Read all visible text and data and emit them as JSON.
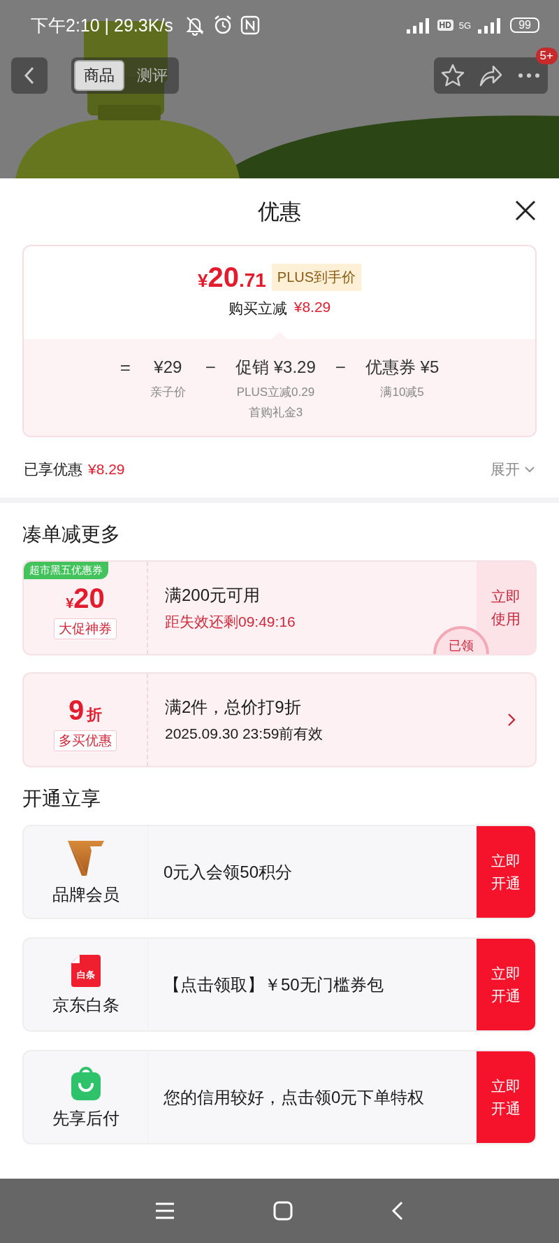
{
  "status_bar": {
    "time": "下午2:10 | 29.3K/s",
    "hd": "HD",
    "network": "5G",
    "battery": "99"
  },
  "header": {
    "tabs": [
      {
        "label": "商品",
        "selected": true
      },
      {
        "label": "测评",
        "selected": false
      }
    ],
    "badge": "5+"
  },
  "sheet": {
    "title": "优惠"
  },
  "price_card": {
    "currency": "¥",
    "price_int": "20",
    "price_dec": ".71",
    "price_tag": "PLUS到手价",
    "saving_label": "购买立减",
    "saving_value": "¥8.29",
    "formula": [
      {
        "kind": "operator",
        "text": "="
      },
      {
        "kind": "term",
        "value": "¥29",
        "notes": [
          "亲子价"
        ]
      },
      {
        "kind": "operator",
        "text": "−"
      },
      {
        "kind": "term",
        "label": "促销",
        "value": "¥3.29",
        "notes": [
          "PLUS立减0.29",
          "首购礼金3"
        ]
      },
      {
        "kind": "operator",
        "text": "−"
      },
      {
        "kind": "term",
        "label": "优惠券",
        "value": "¥5",
        "notes": [
          "满10减5"
        ]
      }
    ]
  },
  "enjoyed": {
    "label": "已享优惠",
    "value": "¥8.29",
    "expand": "展开"
  },
  "bundle": {
    "title": "凑单减更多",
    "offers": [
      {
        "kind": "coupon",
        "tag": "超市黑五优惠券",
        "unit_before": "¥",
        "amount": "20",
        "label": "大促神券",
        "title": "满200元可用",
        "subtitle": "距失效还剩09:49:16",
        "action": "立即使用",
        "stamp": "已领"
      },
      {
        "kind": "discount",
        "amount": "9",
        "unit_after": "折",
        "label": "多买优惠",
        "title": "满2件，总价打9折",
        "subtitle": "2025.09.30 23:59前有效"
      }
    ]
  },
  "membership": {
    "title": "开通立享",
    "items": [
      {
        "kind": "brand",
        "name": "品牌会员",
        "desc": "0元入会领50积分",
        "action": "立即开通"
      },
      {
        "kind": "baitiao",
        "logo_text": "白条",
        "name": "京东白条",
        "desc": "【点击领取】￥50无门槛券包",
        "action": "立即开通"
      },
      {
        "kind": "bag",
        "name": "先享后付",
        "desc": "您的信用较好，点击领0元下单特权",
        "action": "立即开通"
      }
    ]
  }
}
